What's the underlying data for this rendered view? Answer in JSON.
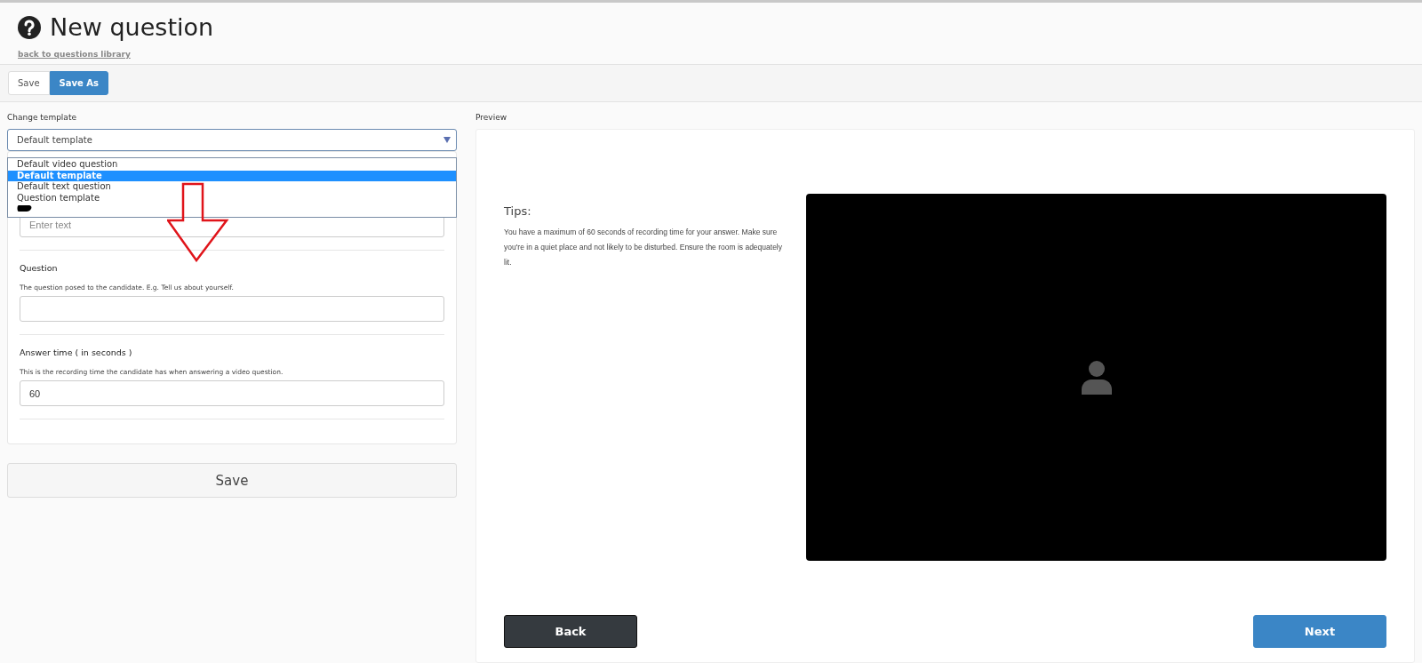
{
  "page": {
    "title": "New question",
    "back_link": "back to questions library"
  },
  "toolbar": [
    {
      "label": "Save",
      "kind": "default"
    },
    {
      "label": "Save As",
      "kind": "primary"
    }
  ],
  "template": {
    "label": "Change template",
    "value": "Default template",
    "options": [
      {
        "kind": "text",
        "label": "Default video question",
        "selected": false
      },
      {
        "kind": "text",
        "label": "Default template",
        "selected": true
      },
      {
        "kind": "text",
        "label": "Default text question",
        "selected": false
      },
      {
        "kind": "text",
        "label": "Question template",
        "selected": false
      },
      {
        "kind": "redacted",
        "selected": false
      }
    ]
  },
  "form": {
    "fields": [
      {
        "placeholder": "Enter text"
      },
      {
        "label": "Question",
        "help": "The question posed to the candidate. E.g. Tell us about yourself."
      },
      {
        "label": "Answer time ( in seconds )",
        "help": "This is the recording time the candidate has when answering a video question.",
        "value": "60"
      }
    ],
    "save_button": "Save"
  },
  "preview": {
    "label": "Preview",
    "tips_title": "Tips:",
    "tips_text": "You have a maximum of 60 seconds of recording time for your answer. Make sure you're in a quiet place and not likely to be disturbed. Ensure the room is adequately lit.",
    "buttons": [
      {
        "label": "Back",
        "kind": "secondary"
      },
      {
        "label": "Next",
        "kind": "primary"
      }
    ]
  }
}
